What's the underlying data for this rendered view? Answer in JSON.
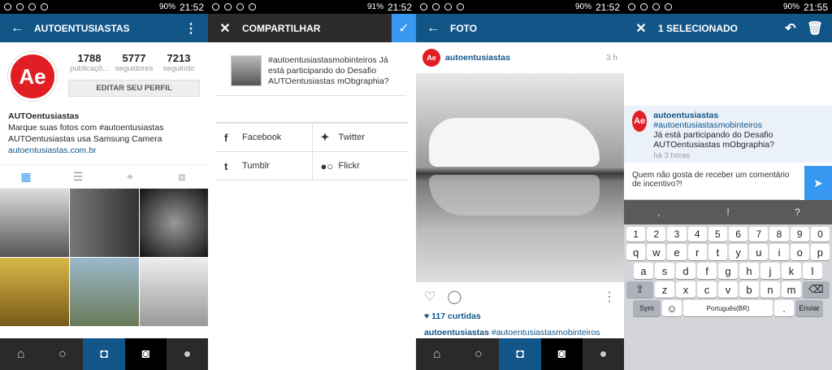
{
  "status": [
    {
      "battery": "90%",
      "time": "21:52"
    },
    {
      "battery": "91%",
      "time": "21:52"
    },
    {
      "battery": "90%",
      "time": "21:52"
    },
    {
      "battery": "90%",
      "time": "21:55"
    }
  ],
  "profile": {
    "title": "AUTOENTUSIASTAS",
    "logo": "Ae",
    "posts": "1788",
    "posts_label": "publicaçõ...",
    "followers": "5777",
    "followers_label": "seguidores",
    "following": "7213",
    "following_label": "seguindo",
    "edit_label": "EDITAR SEU PERFIL",
    "name": "AUTOentusiastas",
    "bio1": "Marque suas fotos com #autoentusiastas",
    "bio2": "AUTOentusiastas usa Samsung Camera",
    "link": "autoentusiastas.com.br"
  },
  "share": {
    "title": "COMPARTILHAR",
    "caption": "#autoentusiastasmobinteiros Já está participando do Desafio AUTOentusiastas mObgraphia?",
    "facebook": "Facebook",
    "twitter": "Twitter",
    "tumblr": "Tumblr",
    "flickr": "Flickr"
  },
  "photo": {
    "title": "FOTO",
    "user": "autoentusiastas",
    "time": "3 h",
    "likes": "♥ 117 curtidas",
    "cap_user": "autoentusiastas",
    "cap_tag": "#autoentusiastasmobinteiros"
  },
  "comment": {
    "title": "1 SELECIONADO",
    "user": "autoentusiastas",
    "tag": "#autoentusiastasmobinteiros",
    "text": "Já está participando do Desafio AUTOentusiastas mObgraphia?",
    "time": "há 3 horas",
    "input": "Quem não gosta de receber um comentário de incentivo?!",
    "sym": "Sym",
    "lang": "Português(BR)",
    "enviar": "Enviar"
  }
}
